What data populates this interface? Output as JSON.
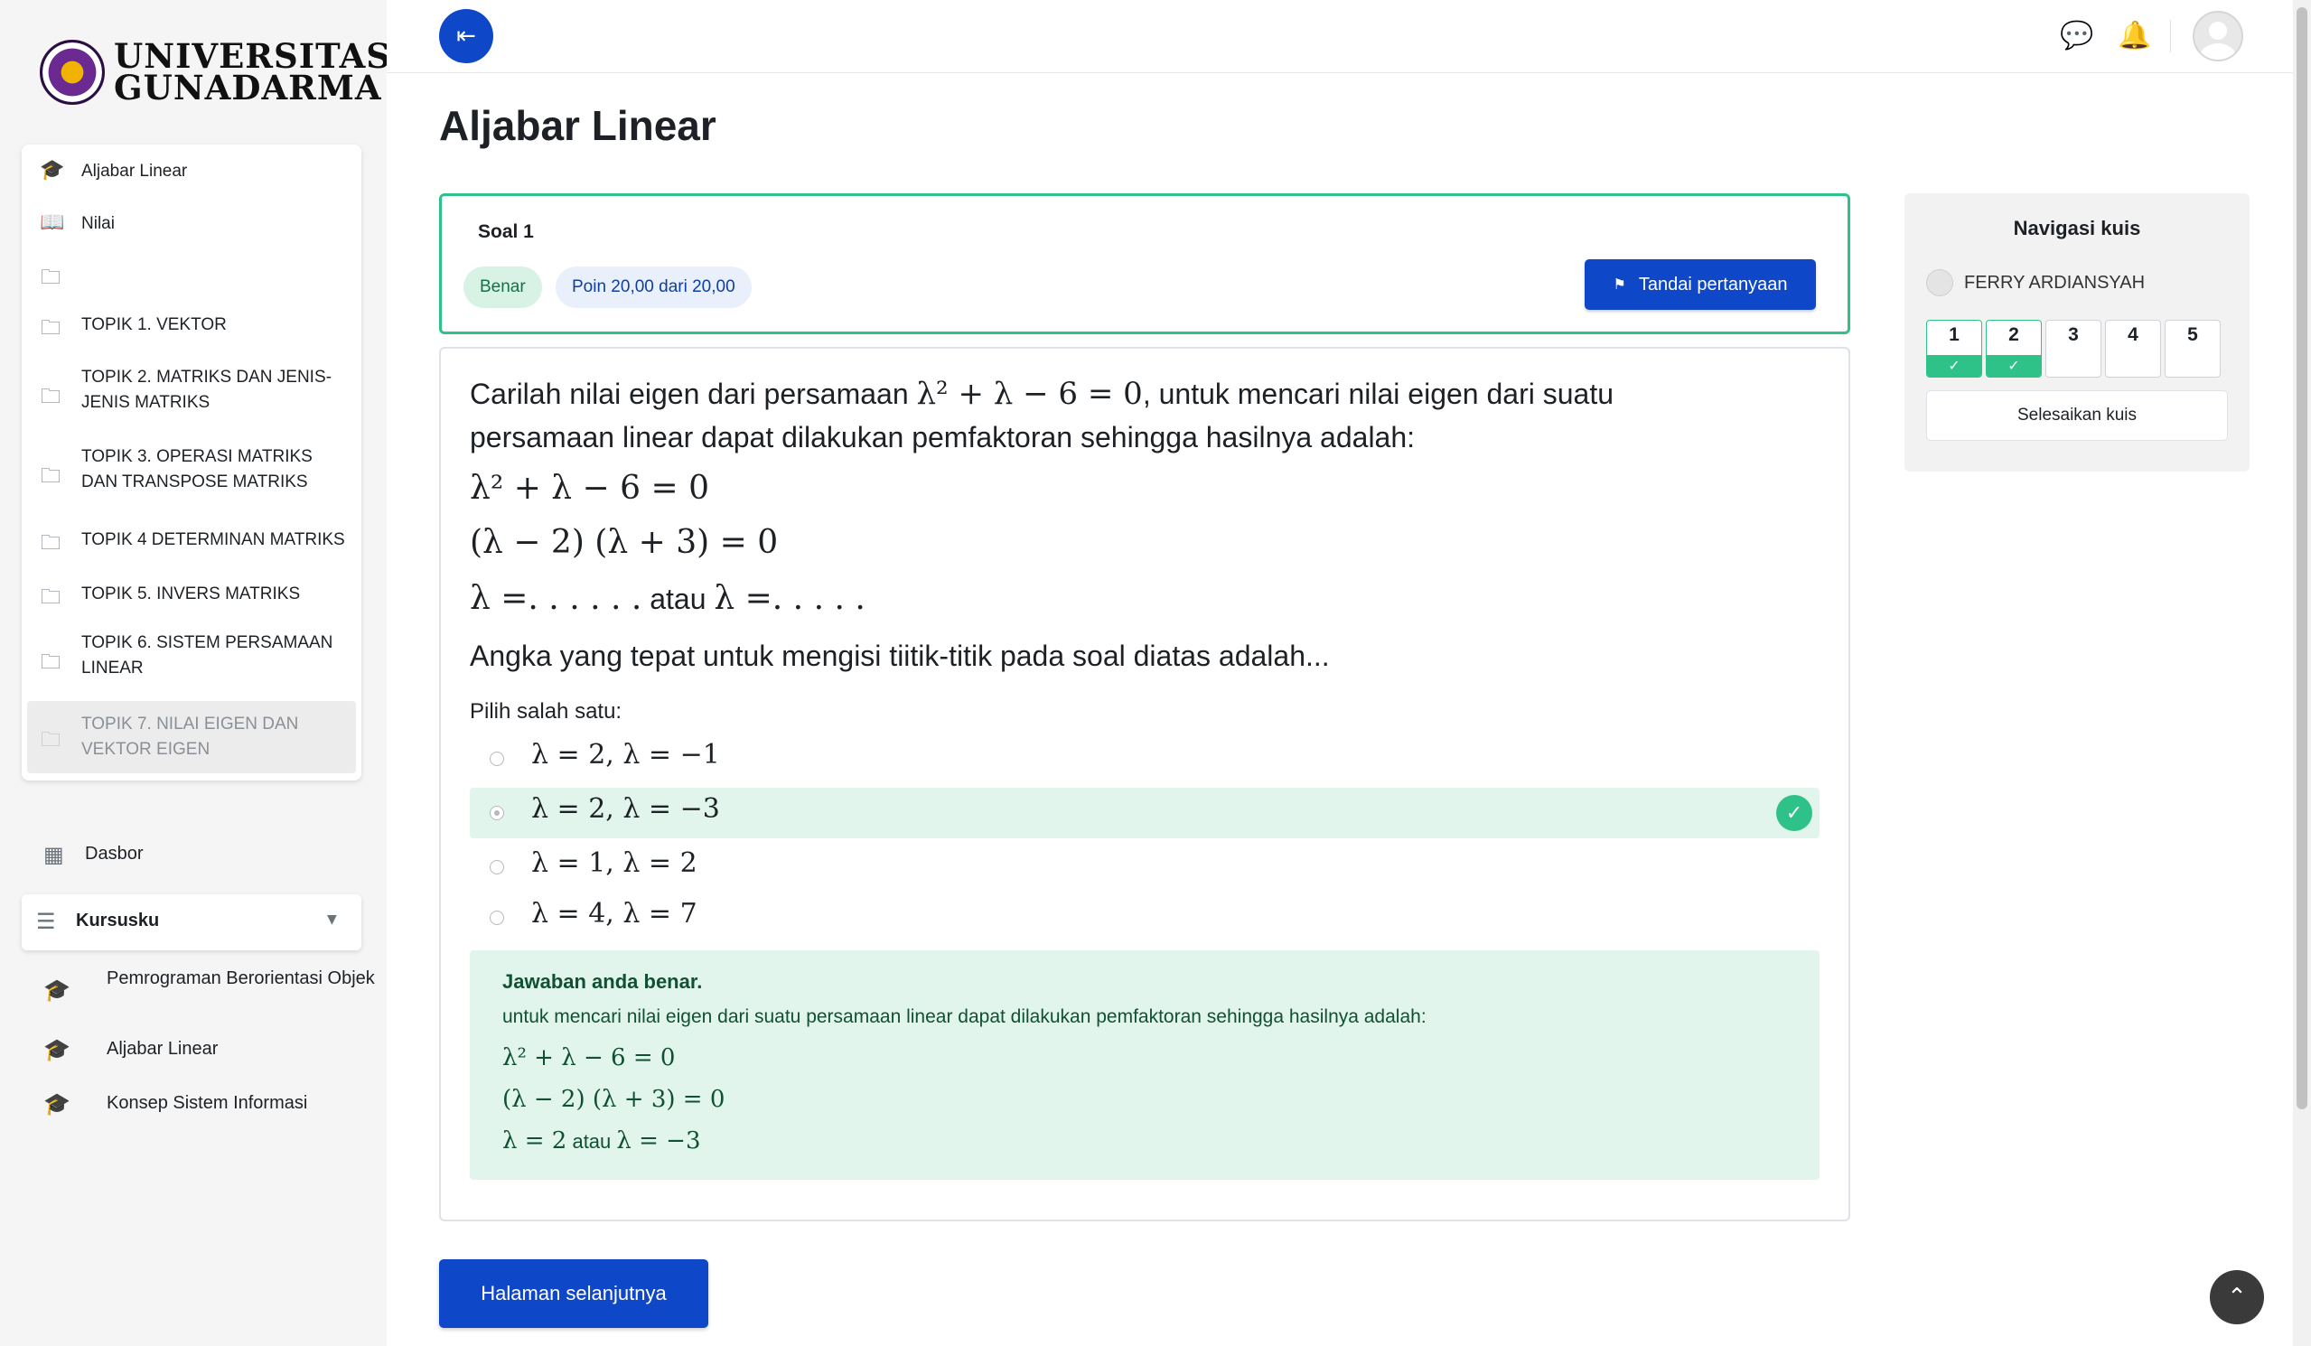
{
  "logo": {
    "line1": "UNIVERSITAS",
    "line2": "GUNADARMA"
  },
  "course_index": [
    {
      "icon": "graduation-cap-icon",
      "label": "Aljabar Linear"
    },
    {
      "icon": "book-icon",
      "label": "Nilai"
    },
    {
      "icon": "folder-icon",
      "label": ""
    },
    {
      "icon": "folder-icon",
      "label": "TOPIK 1. VEKTOR"
    },
    {
      "icon": "folder-icon",
      "label": "TOPIK 2. MATRIKS DAN JENIS-JENIS MATRIKS"
    },
    {
      "icon": "folder-icon",
      "label": "TOPIK 3. OPERASI MATRIKS DAN TRANSPOSE MATRIKS"
    },
    {
      "icon": "folder-icon",
      "label": "TOPIK 4 DETERMINAN MATRIKS"
    },
    {
      "icon": "folder-icon",
      "label": "TOPIK 5. INVERS MATRIKS"
    },
    {
      "icon": "folder-icon",
      "label": "TOPIK 6. SISTEM PERSAMAAN LINEAR"
    },
    {
      "icon": "folder-icon",
      "label": "TOPIK 7. NILAI EIGEN DAN VEKTOR EIGEN"
    }
  ],
  "dasbor_label": "Dasbor",
  "kursusku_label": "Kursusku",
  "my_courses": [
    "Pemrograman Berorientasi Objek",
    "Aljabar Linear",
    "Konsep Sistem Informasi"
  ],
  "page_title": "Aljabar Linear",
  "question": {
    "number_label": "Soal 1",
    "status": "Benar",
    "points": "Poin 20,00 dari 20,00",
    "flag_label": "Tandai pertanyaan",
    "text_line1_a": "Carilah nilai eigen dari persamaan ",
    "text_line1_math": "λ² + λ − 6 = 0",
    "text_line1_b": ", untuk mencari nilai eigen dari suatu",
    "text_line2": "persamaan linear dapat dilakukan pemfaktoran sehingga hasilnya adalah:",
    "math1": "λ² + λ − 6 = 0",
    "math2": "(λ − 2) (λ + 3) = 0",
    "math3_a": "λ =. . . . . .",
    "math3_mid": " atau ",
    "math3_b": "λ =. . . . .",
    "prompt": "Angka yang tepat untuk mengisi tiitik-titik pada soal diatas adalah...",
    "choose_label": "Pilih salah satu:",
    "answers": [
      "λ = 2, λ = −1",
      "λ = 2, λ = −3",
      "λ = 1, λ = 2",
      "λ = 4, λ = 7"
    ],
    "selected_index": 1
  },
  "feedback": {
    "title": "Jawaban anda benar.",
    "text": "untuk mencari nilai eigen dari suatu persamaan linear dapat dilakukan pemfaktoran sehingga hasilnya adalah:",
    "math1": "λ² + λ − 6 = 0",
    "math2": "(λ − 2) (λ + 3) = 0",
    "math3_a": "λ = 2",
    "math3_mid": " atau ",
    "math3_b": "λ = −3"
  },
  "next_button": "Halaman selanjutnya",
  "quiz_nav": {
    "title": "Navigasi kuis",
    "user_name": "FERRY ARDIANSYAH",
    "questions": [
      {
        "label": "1",
        "answered": true
      },
      {
        "label": "2",
        "answered": true
      },
      {
        "label": "3",
        "answered": false
      },
      {
        "label": "4",
        "answered": false
      },
      {
        "label": "5",
        "answered": false
      }
    ],
    "finish_label": "Selesaikan kuis"
  },
  "colors": {
    "primary": "#0f47c9",
    "success": "#2fc288",
    "success_bg": "#e2f5ec"
  }
}
